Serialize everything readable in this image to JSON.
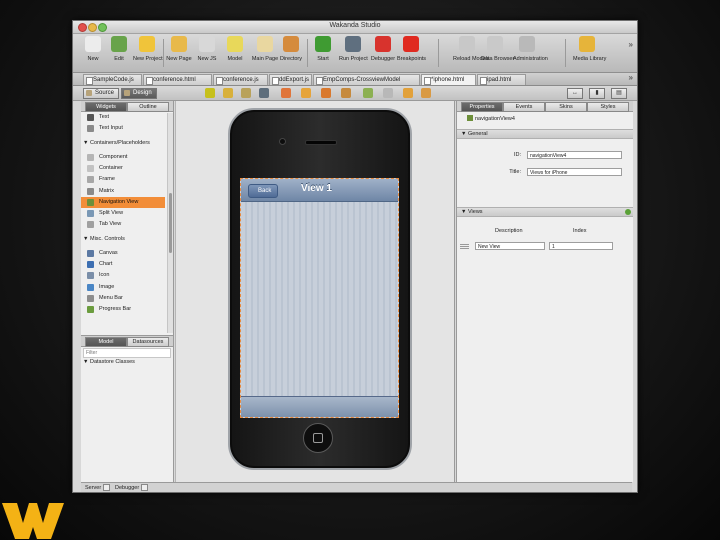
{
  "window": {
    "title": "Wakanda Studio"
  },
  "toolbar": {
    "items": [
      {
        "label": "New",
        "icon": "document-icon",
        "color": "#ececec"
      },
      {
        "label": "Edit",
        "icon": "gears-icon",
        "color": "#68a34a"
      },
      {
        "label": "New Project",
        "icon": "star-icon",
        "color": "#f0c43a"
      },
      {
        "label": "New Page",
        "icon": "page-star-icon",
        "color": "#e8b94a"
      },
      {
        "label": "New JS",
        "icon": "js-file-icon",
        "color": "#d8d8d8"
      },
      {
        "label": "Model",
        "icon": "model-icon",
        "color": "#e8d85a"
      },
      {
        "label": "Main Page",
        "icon": "envelope-icon",
        "color": "#e9d7a0"
      },
      {
        "label": "Directory",
        "icon": "people-icon",
        "color": "#d58b3d"
      },
      {
        "label": "Start",
        "icon": "play-icon",
        "color": "#3f9b32"
      },
      {
        "label": "Run Project",
        "icon": "run-icon",
        "color": "#5f6f7f"
      },
      {
        "label": "Debugger",
        "icon": "bug-icon",
        "color": "#d8332d"
      },
      {
        "label": "Breakpoints",
        "icon": "record-icon",
        "color": "#e02a20"
      },
      {
        "label": "Reload Models",
        "icon": "reload-icon",
        "color": "#c8c8c8"
      },
      {
        "label": "Data Browser",
        "icon": "grid-icon",
        "color": "#c9c9c9"
      },
      {
        "label": "Administration",
        "icon": "gear-icon",
        "color": "#b9b9b9"
      },
      {
        "label": "Media Library",
        "icon": "folder-icon",
        "color": "#e6b43a"
      }
    ],
    "overflow": "»"
  },
  "file_tabs": [
    {
      "label": "SampleCode.js",
      "active": false
    },
    {
      "label": "conference.html",
      "active": false
    },
    {
      "label": "conference.js",
      "active": false
    },
    {
      "label": "ddExport.js",
      "active": false
    },
    {
      "label": "EmpComps-CrossviewModel",
      "active": false
    },
    {
      "label": "*iphone.html",
      "active": true
    },
    {
      "label": "ipad.html",
      "active": false
    }
  ],
  "tabs_overflow": "»",
  "mode": {
    "source": "Source",
    "design": "Design",
    "active": "Design"
  },
  "left_panel": {
    "tabs": [
      "Widgets",
      "Outline"
    ],
    "active_tab": "Widgets",
    "rows": [
      {
        "kind": "item",
        "label": "Text",
        "icon": "text-icon",
        "color": "#555555"
      },
      {
        "kind": "item",
        "label": "Text Input",
        "icon": "text-input-icon",
        "color": "#8a8a8a"
      },
      {
        "kind": "group",
        "label": "Containers/Placeholders"
      },
      {
        "kind": "item",
        "label": "Component",
        "icon": "component-icon",
        "color": "#b5b5b5"
      },
      {
        "kind": "item",
        "label": "Container",
        "icon": "container-icon",
        "color": "#c2c2c2"
      },
      {
        "kind": "item",
        "label": "Frame",
        "icon": "frame-icon",
        "color": "#a7a7a7"
      },
      {
        "kind": "item",
        "label": "Matrix",
        "icon": "matrix-icon",
        "color": "#8a8a8a"
      },
      {
        "kind": "item",
        "label": "Navigation View",
        "icon": "navigation-view-icon",
        "color": "#6d8f3a",
        "selected": true
      },
      {
        "kind": "item",
        "label": "Split View",
        "icon": "split-view-icon",
        "color": "#7a98b5"
      },
      {
        "kind": "item",
        "label": "Tab View",
        "icon": "tab-view-icon",
        "color": "#a0a0a0"
      },
      {
        "kind": "group",
        "label": "Misc. Controls"
      },
      {
        "kind": "item",
        "label": "Canvas",
        "icon": "canvas-icon",
        "color": "#5b79a3"
      },
      {
        "kind": "item",
        "label": "Chart",
        "icon": "chart-icon",
        "color": "#3d6fb2"
      },
      {
        "kind": "item",
        "label": "Icon",
        "icon": "icon-icon",
        "color": "#7a8ea8"
      },
      {
        "kind": "item",
        "label": "Image",
        "icon": "image-icon",
        "color": "#4a86c5"
      },
      {
        "kind": "item",
        "label": "Menu Bar",
        "icon": "menu-bar-icon",
        "color": "#8d8d8d"
      },
      {
        "kind": "item",
        "label": "Progress Bar",
        "icon": "progress-bar-icon",
        "color": "#6b9c3e"
      }
    ],
    "lower_tabs": [
      "Model",
      "Datasources"
    ],
    "lower_active": "Model",
    "filter_placeholder": "Filter",
    "datastore_label": "Datastore Classes"
  },
  "phone": {
    "nav_title": "View 1",
    "back_label": "Back"
  },
  "right_panel": {
    "tabs": [
      "Properties",
      "Events",
      "Skins",
      "Styles"
    ],
    "active_tab": "Properties",
    "object_name": "navigationView4",
    "general_label": "General",
    "id_label": "ID:",
    "id_value": "navigationView4",
    "title_label": "Title:",
    "title_value": "Views for iPhone",
    "views_label": "Views",
    "col_description": "Description",
    "col_index": "Index",
    "view_description": "New View",
    "view_index": "1"
  },
  "status_bar": {
    "server": "Server",
    "debugger": "Debugger"
  },
  "colors": {
    "accent_selection": "#f28d38",
    "logo_gold": "#f4b215"
  }
}
